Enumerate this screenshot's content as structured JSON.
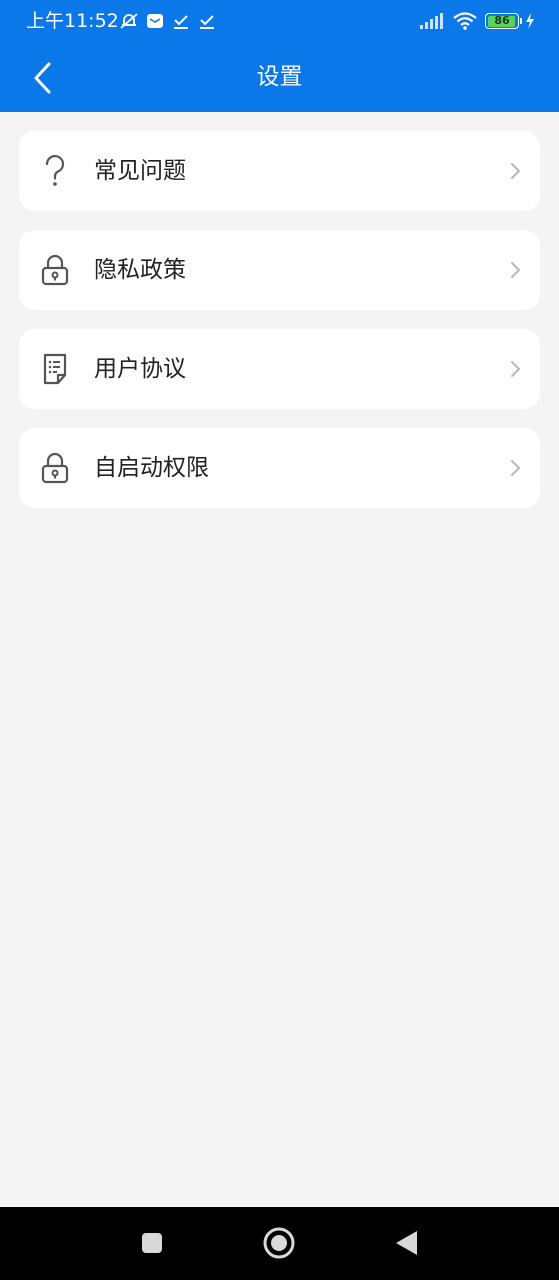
{
  "status_bar": {
    "time": "上午11:52",
    "battery_level": "86",
    "icons_left": [
      "muted-notification-icon",
      "message-icon",
      "check-icon",
      "check-icon"
    ],
    "icons_right": [
      "signal-icon",
      "wifi-icon",
      "battery-icon",
      "charging-icon"
    ]
  },
  "header": {
    "title": "设置",
    "back_icon": "chevron-left-icon"
  },
  "menu": {
    "items": [
      {
        "label": "常见问题",
        "icon": "question-icon"
      },
      {
        "label": "隐私政策",
        "icon": "lock-icon"
      },
      {
        "label": "用户协议",
        "icon": "document-icon"
      },
      {
        "label": "自启动权限",
        "icon": "lock-icon"
      }
    ]
  },
  "navigation_bar": {
    "buttons": [
      "recents-icon",
      "home-icon",
      "back-icon"
    ]
  },
  "colors": {
    "primary": "#0a78e8",
    "background": "#f4f4f4",
    "card": "#ffffff",
    "text": "#222222",
    "battery_fill": "#58d45a"
  }
}
